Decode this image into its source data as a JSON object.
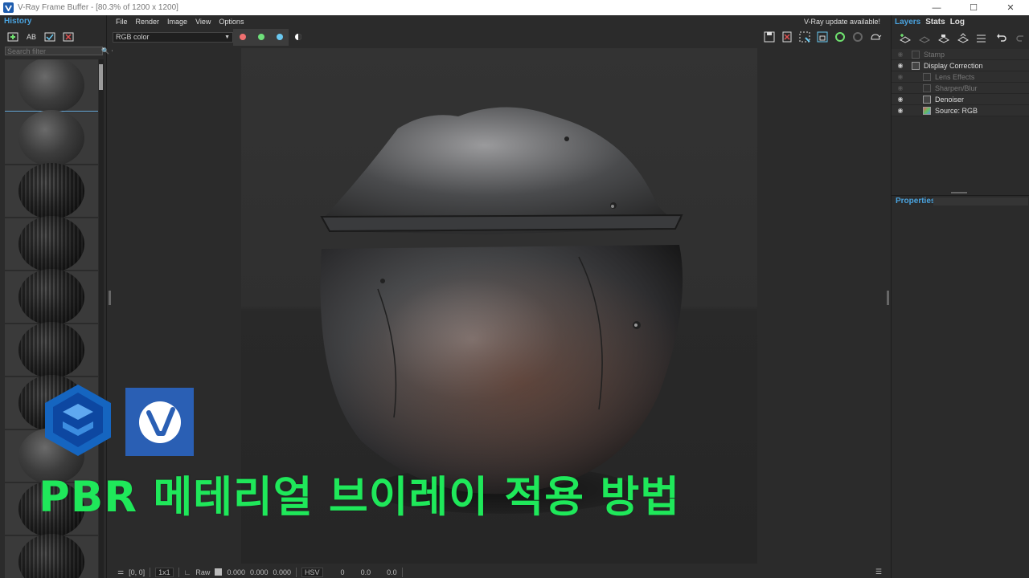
{
  "window": {
    "title": "V-Ray Frame Buffer - [80.3% of 1200 x 1200]",
    "controls": [
      "minimize-icon",
      "maximize-icon",
      "close-icon"
    ]
  },
  "history": {
    "title": "History",
    "search_placeholder": "Search filter",
    "toolbar_icons": [
      "save-to-history-icon",
      "ab-compare-icon",
      "load-history-icon",
      "remove-history-icon"
    ],
    "thumbnails": 10
  },
  "menu": {
    "items": [
      "File",
      "Render",
      "Image",
      "View",
      "Options"
    ],
    "update_notice": "V-Ray update available!"
  },
  "toolbar": {
    "channel": "RGB color",
    "channel_buttons": [
      {
        "name": "red-channel",
        "color": "#f07070"
      },
      {
        "name": "green-channel",
        "color": "#6ee07a"
      },
      {
        "name": "blue-channel",
        "color": "#6ac8f0"
      }
    ]
  },
  "statusbar": {
    "coords": "[0, 0]",
    "sampling": "1x1",
    "raw_label": "Raw",
    "rgb_values": [
      "0.000",
      "0.000",
      "0.000"
    ],
    "color_mode": "HSV",
    "hsv_values": [
      "0",
      "0.0",
      "0.0"
    ]
  },
  "right_panel": {
    "tabs": [
      "Layers",
      "Stats",
      "Log"
    ],
    "active_tab": "Layers",
    "layers": [
      {
        "label": "Stamp",
        "dim": true,
        "indent": false
      },
      {
        "label": "Display Correction",
        "dim": false,
        "indent": false
      },
      {
        "label": "Lens Effects",
        "dim": true,
        "indent": true
      },
      {
        "label": "Sharpen/Blur",
        "dim": true,
        "indent": true
      },
      {
        "label": "Denoiser",
        "dim": false,
        "indent": true
      },
      {
        "label": "Source: RGB",
        "dim": false,
        "indent": true
      }
    ],
    "properties_title": "Properties"
  },
  "overlay": {
    "headline": "PBR 메테리얼 브이레이 적용 방법",
    "headline_color": "#1fe85a",
    "logos": [
      "sketchup-logo",
      "vray-logo"
    ]
  }
}
